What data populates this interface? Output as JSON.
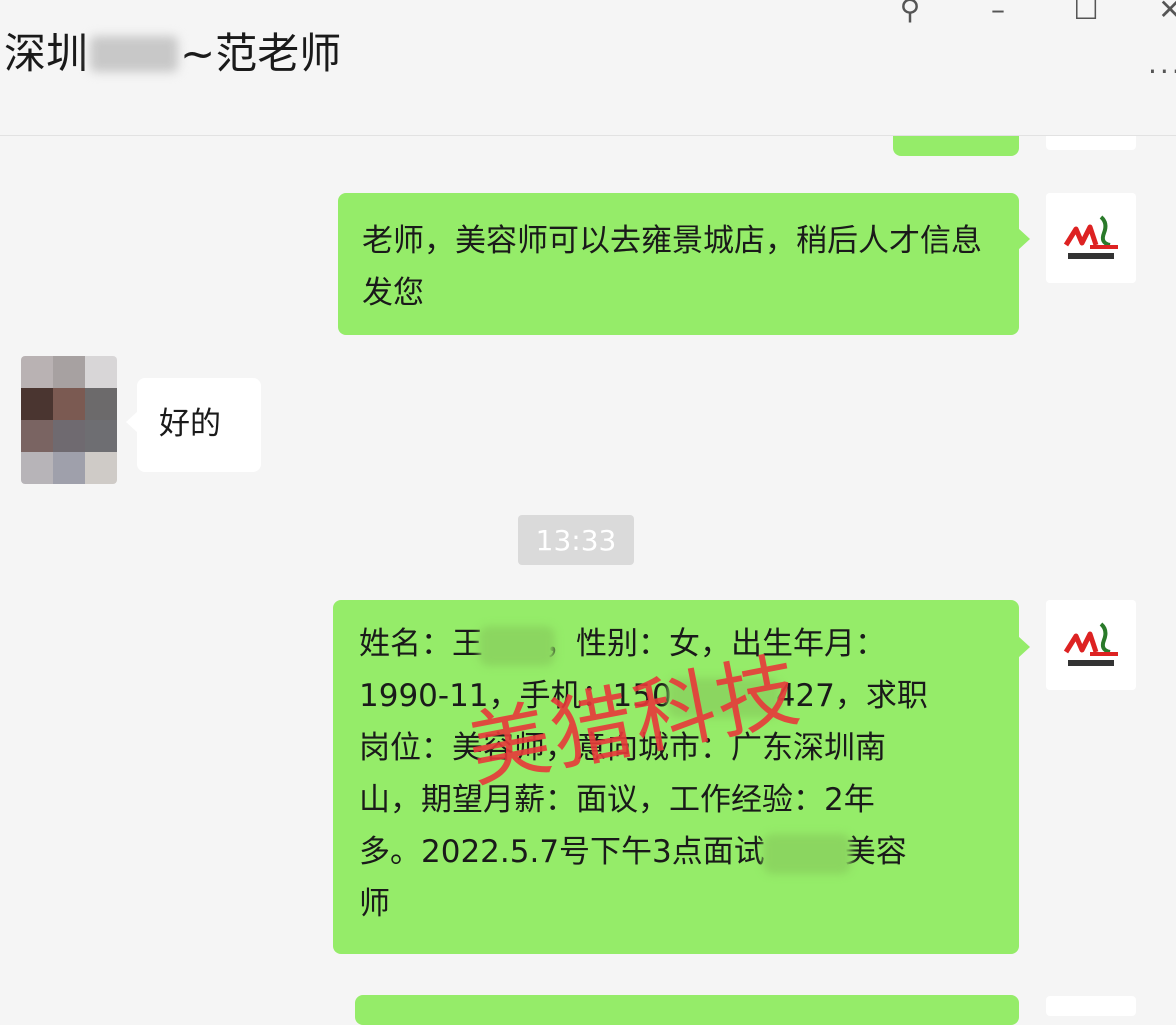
{
  "window": {
    "chat_title_prefix": "深圳",
    "chat_title_suffix": "~范老师",
    "controls": {
      "pin": "⚲",
      "minimize": "–",
      "maximize": "☐",
      "close": "✕",
      "more": "···"
    }
  },
  "messages": [
    {
      "side": "right",
      "avatar_icon": "company-logo-icon",
      "text": "老师，美容师可以去雍景城店，稍后人才信息发您"
    },
    {
      "side": "left",
      "avatar_icon": "pixelated-avatar",
      "text": "好的"
    },
    {
      "type": "timestamp",
      "text": "13:33"
    },
    {
      "side": "right",
      "avatar_icon": "company-logo-icon",
      "lines": [
        [
          "姓名：王",
          "，性别：女，出生年月："
        ],
        [
          "1990-11，手机：150",
          "427，求职"
        ],
        [
          "岗位：美容师，意向城市：广东深圳南",
          ""
        ],
        [
          "山，期望月薪：面议，工作经验：2年",
          ""
        ],
        [
          "多。2022.5.7号下午3点面试",
          "美容"
        ],
        [
          "师",
          ""
        ]
      ]
    }
  ],
  "watermark": "美猎科技",
  "colors": {
    "green_bubble": "#95ec69",
    "white_bubble": "#ffffff",
    "background": "#f5f5f5",
    "watermark": "#e8393a"
  }
}
